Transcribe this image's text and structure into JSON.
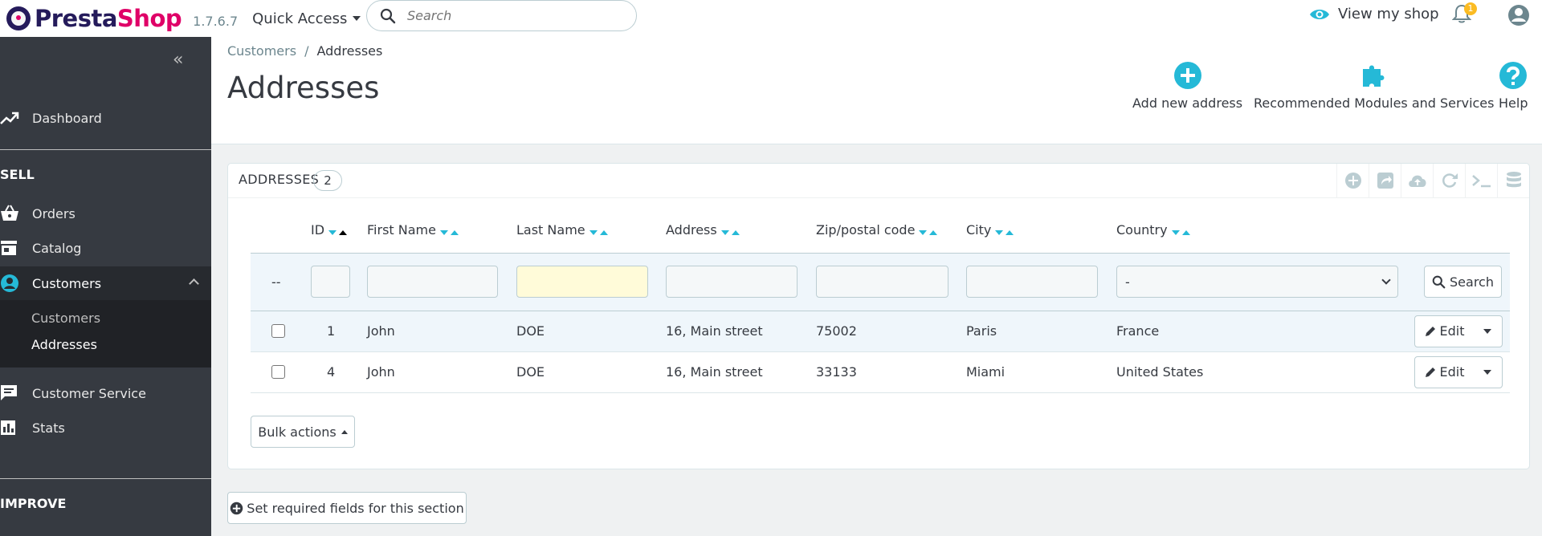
{
  "header": {
    "logo_part1": "Presta",
    "logo_part2": "Shop",
    "version": "1.7.6.7",
    "quick_access": "Quick Access",
    "search_placeholder": "Search",
    "view_shop": "View my shop",
    "notification_count": "1"
  },
  "sidebar": {
    "dashboard": "Dashboard",
    "sell_title": "SELL",
    "orders": "Orders",
    "catalog": "Catalog",
    "customers": "Customers",
    "sub_customers": "Customers",
    "sub_addresses": "Addresses",
    "customer_service": "Customer Service",
    "stats": "Stats",
    "improve_title": "IMPROVE"
  },
  "page": {
    "breadcrumb_parent": "Customers",
    "breadcrumb_sep": "/",
    "breadcrumb_current": "Addresses",
    "title": "Addresses",
    "toolbar": {
      "add": "Add new address",
      "modules": "Recommended Modules and Services",
      "help": "Help"
    }
  },
  "panel": {
    "title": "ADDRESSES",
    "count": "2",
    "columns": {
      "id": "ID",
      "first_name": "First Name",
      "last_name": "Last Name",
      "address": "Address",
      "zip": "Zip/postal code",
      "city": "City",
      "country": "Country"
    },
    "filter": {
      "dash": "--",
      "country_selected": "-",
      "search_label": "Search"
    },
    "rows": [
      {
        "id": "1",
        "first_name": "John",
        "last_name": "DOE",
        "address": "16, Main street",
        "zip": "75002",
        "city": "Paris",
        "country": "France",
        "edit": "Edit"
      },
      {
        "id": "4",
        "first_name": "John",
        "last_name": "DOE",
        "address": "16, Main street",
        "zip": "33133",
        "city": "Miami",
        "country": "United States",
        "edit": "Edit"
      }
    ],
    "bulk_actions": "Bulk actions"
  },
  "required_fields": "Set required fields for this section",
  "colors": {
    "accent": "#25b9d7",
    "sidebar": "#363a41",
    "brand_pink": "#df0067",
    "brand_navy": "#251b5b"
  }
}
